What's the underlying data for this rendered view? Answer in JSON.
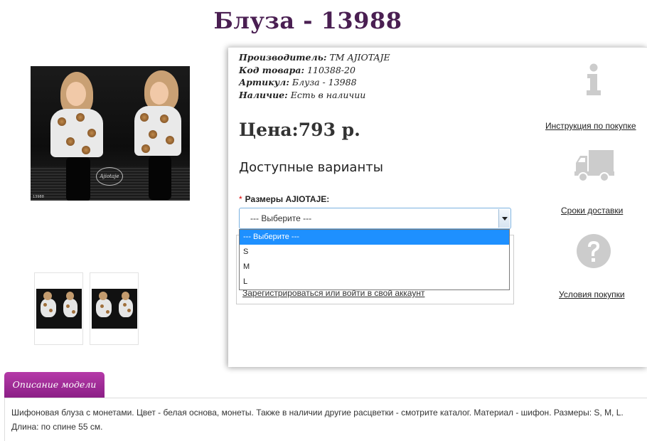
{
  "product": {
    "title": "Блуза - 13988",
    "photo_caption": "13988",
    "photo_logo": "Ajiotaje"
  },
  "meta": {
    "manufacturer_label": "Производитель:",
    "manufacturer_value": "ТМ AJIOTAJE",
    "code_label": "Код товара:",
    "code_value": "110388-20",
    "article_label": "Артикул:",
    "article_value": "Блуза - 13988",
    "availability_label": "Наличие:",
    "availability_value": "Есть в наличии"
  },
  "price": {
    "text": "Цена:793 р."
  },
  "variants": {
    "heading": "Доступные варианты",
    "required_mark": "*",
    "size_label": "Размеры AJIOTAJE:",
    "selected": "--- Выберите ---",
    "options": [
      "--- Выберите ---",
      "S",
      "M",
      "L"
    ]
  },
  "register": {
    "link": "Зарегистрироваться или войти в свой аккаунт"
  },
  "sidebar": {
    "instruction": "Инструкция по покупке",
    "delivery": "Сроки доставки",
    "terms": "Условия покупки"
  },
  "description": {
    "tab": "Описание модели",
    "text": "Шифоновая блуза с монетами. Цвет - белая основа, монеты. Также в наличии другие расцветки - смотрите каталог. Материал - шифон. Размеры: S, M, L. Длина: по спине 55 см."
  },
  "colors": {
    "title": "#4a1f52",
    "tab": "#9c2a95",
    "dropdown_highlight": "#1e90ff",
    "icon_gray": "#cccccc"
  }
}
